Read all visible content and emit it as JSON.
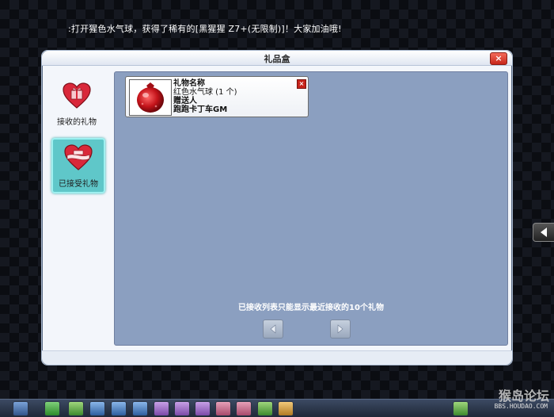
{
  "announcement": ":打开猩色水气球，获得了稀有的[黑猩猩 Z7+(无限制)]！大家加油哦!",
  "window": {
    "title": "礼品盒",
    "close_label": "×"
  },
  "sidebar": {
    "items": [
      {
        "label": "接收的礼物",
        "icon": "heart-gift-icon",
        "selected": false
      },
      {
        "label": "已接受礼物",
        "icon": "heart-ribbon-icon",
        "selected": true
      }
    ]
  },
  "gift": {
    "name_label": "礼物名称",
    "item": "红色水气球 (1 个)",
    "sender_label": "赠送人",
    "sender": "跑跑卡丁车GM",
    "icon": "red-water-balloon-icon",
    "remove_label": "×"
  },
  "notice": "已接收列表只能显示最近接收的10个礼物",
  "pager": {
    "prev_icon": "arrow-left-icon",
    "next_icon": "arrow-right-icon"
  },
  "watermark": {
    "logo_text": "猴岛论坛",
    "url": "BBS.HOUDAO.COM"
  },
  "colors": {
    "content_bg": "#8b9fc0",
    "selected_tab": "#5fc7c9",
    "close_red": "#c6261a",
    "heart_red": "#d9283a"
  }
}
